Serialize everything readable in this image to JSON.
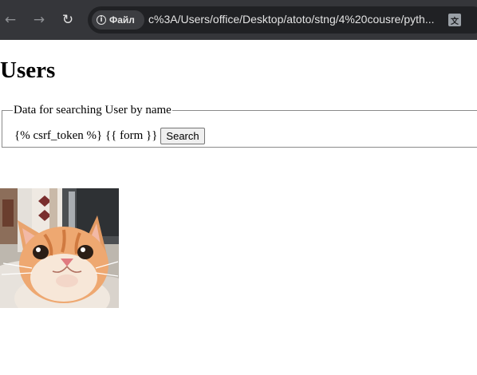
{
  "browser": {
    "back_icon": "arrow-left-icon",
    "forward_icon": "arrow-right-icon",
    "reload_icon": "reload-icon",
    "site_info_label": "Файл",
    "url": "c%3A/Users/office/Desktop/atoto/stng/4%20cousre/pyth...",
    "translate_icon": "translate-icon"
  },
  "page": {
    "title": "Users",
    "fieldset": {
      "legend": "Data for searching User by name",
      "template_text": "{% csrf_token %} {{ form }}",
      "search_button": "Search"
    },
    "image": "cat-photo"
  }
}
